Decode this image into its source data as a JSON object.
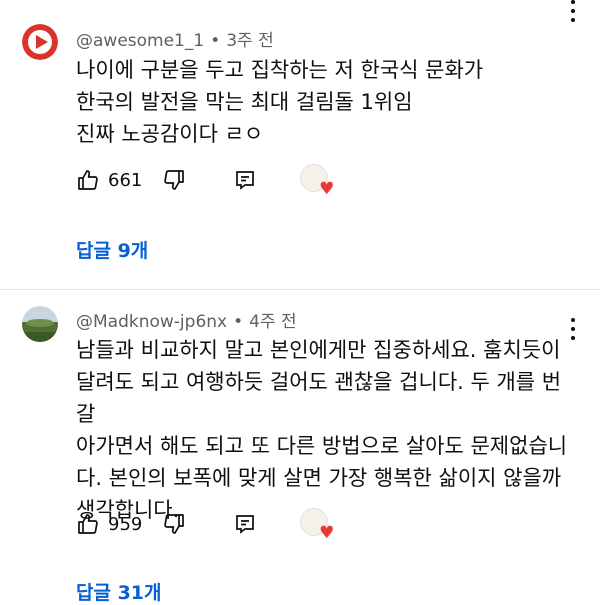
{
  "comments": [
    {
      "author": "@awesome1_1",
      "time": "3주 전",
      "text": "나이에 구분을 두고 집착하는 저 한국식 문화가\n한국의 발전을 막는 최대 걸림돌 1위임\n진짜 노공감이다 ㄹㅇ",
      "likes": "661",
      "replies": "답글 9개",
      "avatar_color": "#e53935"
    },
    {
      "author": "@Madknow-jp6nx",
      "time": "4주 전",
      "text": "남들과 비교하지 말고 본인에게만 집중하세요. 훔치듯이\n달려도 되고 여행하듯 걸어도 괜찮을 겁니다. 두 개를 번갈\n아가면서 해도 되고 또 다른 방법으로 살아도 문제없습니\n다. 본인의 보폭에 맞게 살면 가장 행복한 삶이지 않을까\n생각합니다.",
      "likes": "959",
      "replies": "답글 31개",
      "avatar_color": "#5a7a3a"
    }
  ],
  "meta_separator": "•",
  "colors": {
    "link": "#065fd4",
    "heart": "#e53935",
    "meta": "#606060"
  },
  "icons": [
    "thumb-up-icon",
    "thumb-down-icon",
    "reply-icon",
    "more-vert-icon",
    "heart-icon"
  ]
}
